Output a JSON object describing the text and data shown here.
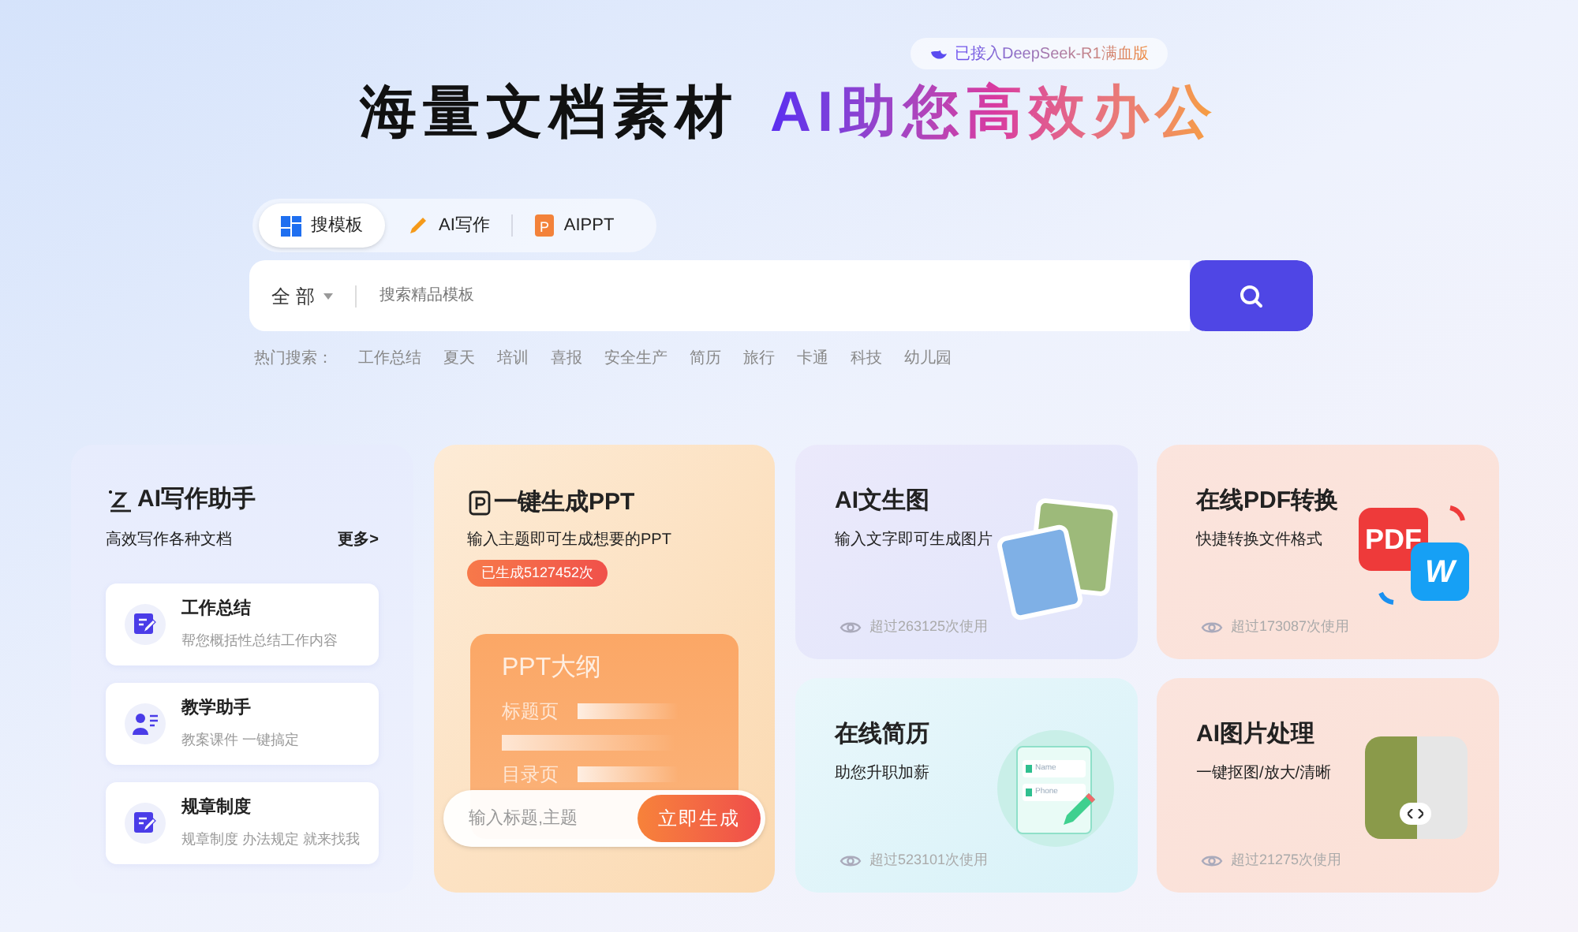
{
  "badge": "已接入DeepSeek-R1满血版",
  "headline": {
    "plain": "海量文档素材",
    "gradient": "AI助您高效办公"
  },
  "tabs": [
    {
      "label": "搜模板",
      "selected": true
    },
    {
      "label": "AI写作",
      "selected": false
    },
    {
      "label": "AIPPT",
      "selected": false,
      "icon_text": "P"
    }
  ],
  "search": {
    "scope": "全 部",
    "placeholder": "搜索精品模板"
  },
  "hot_search": {
    "label": "热门搜索：",
    "terms": [
      "工作总结",
      "夏天",
      "培训",
      "喜报",
      "安全生产",
      "简历",
      "旅行",
      "卡通",
      "科技",
      "幼儿园"
    ]
  },
  "writing_card": {
    "title": "AI写作助手",
    "subtitle": "高效写作各种文档",
    "more": "更多>",
    "items": [
      {
        "title": "工作总结",
        "desc": "帮您概括性总结工作内容",
        "kind": "doc"
      },
      {
        "title": "教学助手",
        "desc": "教案课件 一键搞定",
        "kind": "teacher"
      },
      {
        "title": "规章制度",
        "desc": "规章制度 办法规定 就来找我",
        "kind": "doc"
      }
    ]
  },
  "ppt_card": {
    "title": "一键生成PPT",
    "subtitle": "输入主题即可生成想要的PPT",
    "count": "已生成5127452次",
    "outline": {
      "title": "PPT大纲",
      "rows": [
        "标题页",
        "目录页"
      ]
    },
    "placeholder": "输入标题,主题",
    "button": "立即生成"
  },
  "tool_cards": [
    {
      "title": "AI文生图",
      "subtitle": "输入文字即可生成图片",
      "usage": "超过263125次使用",
      "kind": "image"
    },
    {
      "title": "在线PDF转换",
      "subtitle": "快捷转换文件格式",
      "usage": "超过173087次使用",
      "kind": "pdf",
      "labels": [
        "PDF",
        "W"
      ]
    },
    {
      "title": "在线简历",
      "subtitle": "助您升职加薪",
      "usage": "超过523101次使用",
      "kind": "resume",
      "labels": [
        "Name",
        "Phone"
      ]
    },
    {
      "title": "AI图片处理",
      "subtitle": "一键抠图/放大/清晰",
      "usage": "超过21275次使用",
      "kind": "cutout"
    }
  ]
}
